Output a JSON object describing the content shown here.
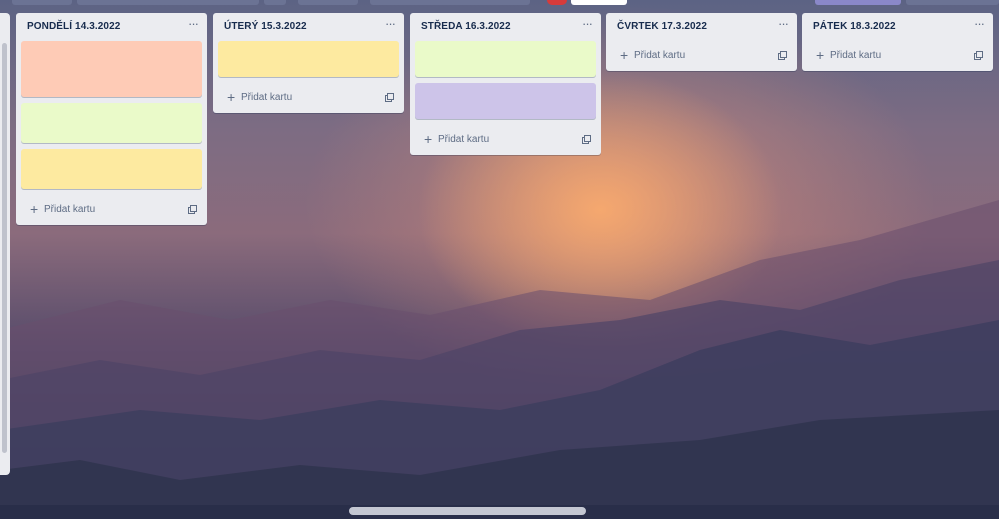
{
  "colors": {
    "card_salmon": "#fecbb6",
    "card_green": "#eafac9",
    "card_yellow": "#fdeaa0",
    "card_purple": "#cdc4e9",
    "list_bg": "#ebecf0"
  },
  "lists": [
    {
      "title": "PONDĚLÍ 14.3.2022",
      "menu_icon": "ellipsis-icon",
      "cards": [
        {
          "color": "#fecbb6"
        },
        {
          "color": "#eafac9"
        },
        {
          "color": "#fdeaa0"
        }
      ],
      "add_label": "Přidat kartu",
      "template_icon": "template-icon"
    },
    {
      "title": "ÚTERÝ 15.3.2022",
      "menu_icon": "ellipsis-icon",
      "cards": [
        {
          "color": "#fdeaa0"
        }
      ],
      "add_label": "Přidat kartu",
      "template_icon": "template-icon"
    },
    {
      "title": "STŘEDA 16.3.2022",
      "menu_icon": "ellipsis-icon",
      "cards": [
        {
          "color": "#eafac9"
        },
        {
          "color": "#cdc4e9"
        }
      ],
      "add_label": "Přidat kartu",
      "template_icon": "template-icon"
    },
    {
      "title": "ČVRTEK 17.3.2022",
      "menu_icon": "ellipsis-icon",
      "cards": [],
      "add_label": "Přidat kartu",
      "template_icon": "template-icon"
    },
    {
      "title": "PÁTEK 18.3.2022",
      "menu_icon": "ellipsis-icon",
      "cards": [],
      "add_label": "Přidat kartu",
      "template_icon": "template-icon"
    }
  ]
}
